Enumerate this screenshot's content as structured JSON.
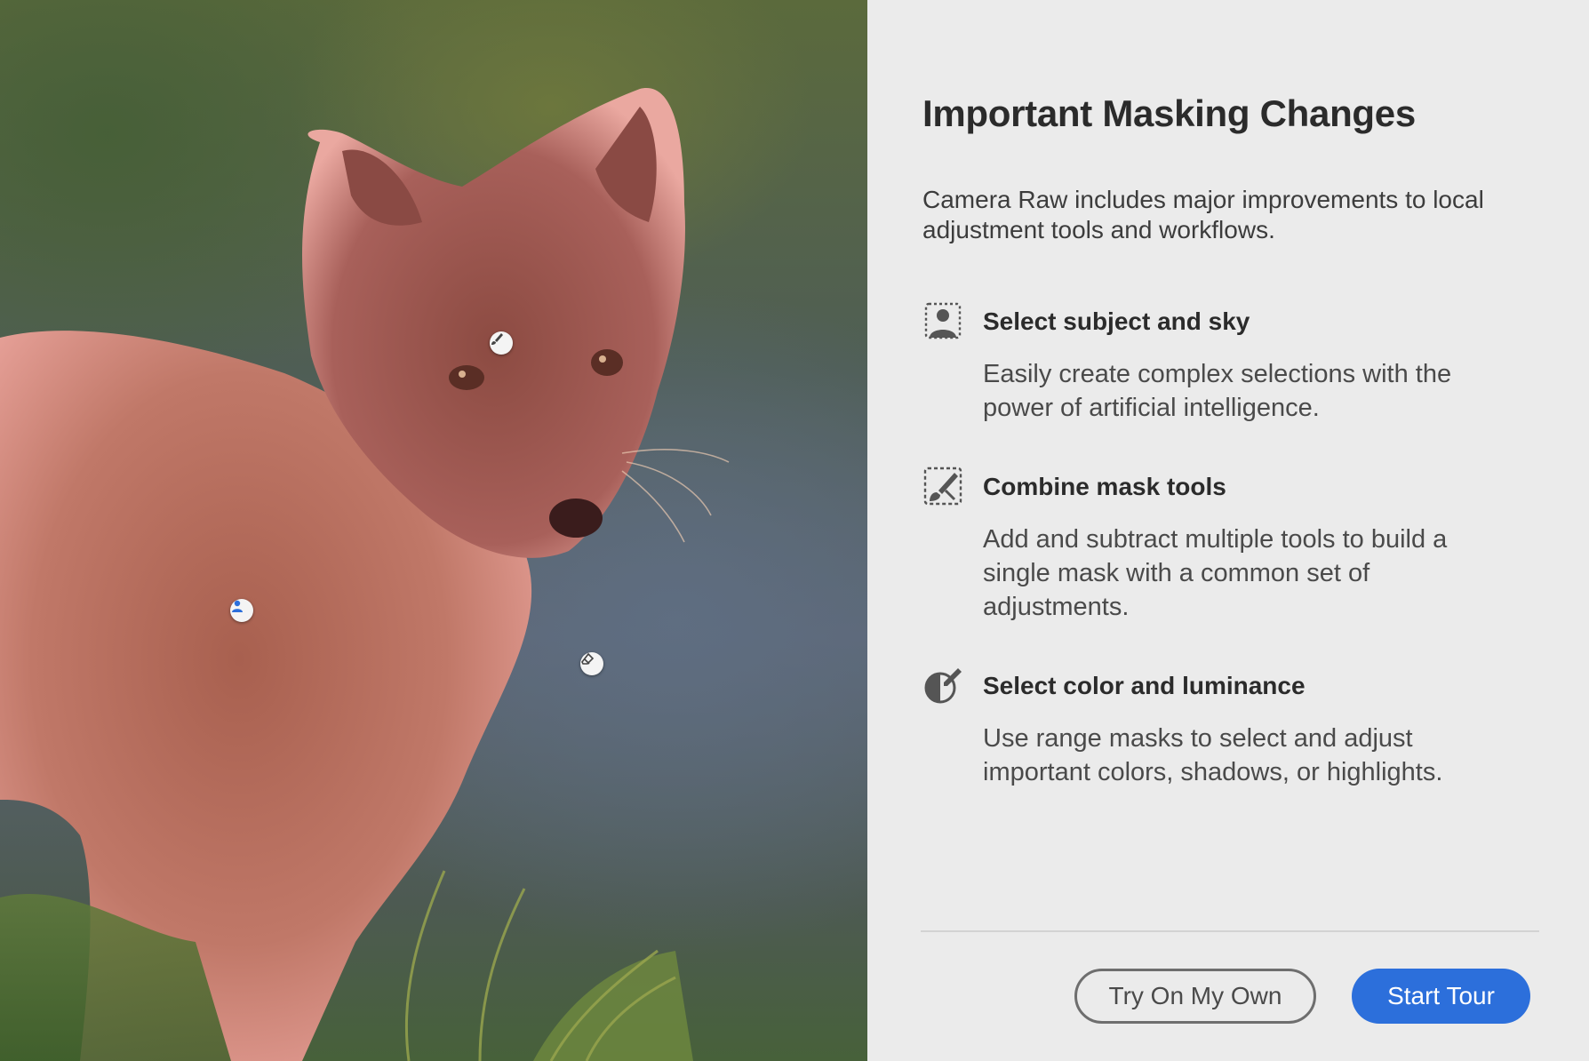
{
  "dialog": {
    "title": "Important Masking Changes",
    "intro": "Camera Raw includes major improvements to local adjustment tools and workflows.",
    "features": [
      {
        "icon": "select-subject-icon",
        "heading": "Select subject and sky",
        "description": "Easily create complex selections with the power of artificial intelligence."
      },
      {
        "icon": "combine-mask-tools-icon",
        "heading": "Combine mask tools",
        "description": "Add and subtract multiple tools to build a single mask with a common set of adjustments."
      },
      {
        "icon": "color-range-icon",
        "heading": "Select color and luminance",
        "description": "Use range masks to select and adjust important colors, shadows, or highlights."
      }
    ],
    "buttons": {
      "secondary_label": "Try On My Own",
      "primary_label": "Start Tour"
    }
  },
  "photo": {
    "subject": "arctic fox with red mask overlay",
    "mask_color": "#e07a78",
    "pins": [
      "brush-pin-icon",
      "subject-pin-icon",
      "eraser-pin-icon"
    ]
  },
  "colors": {
    "primary_button": "#2c6fdb",
    "panel_background": "#ebebeb"
  }
}
